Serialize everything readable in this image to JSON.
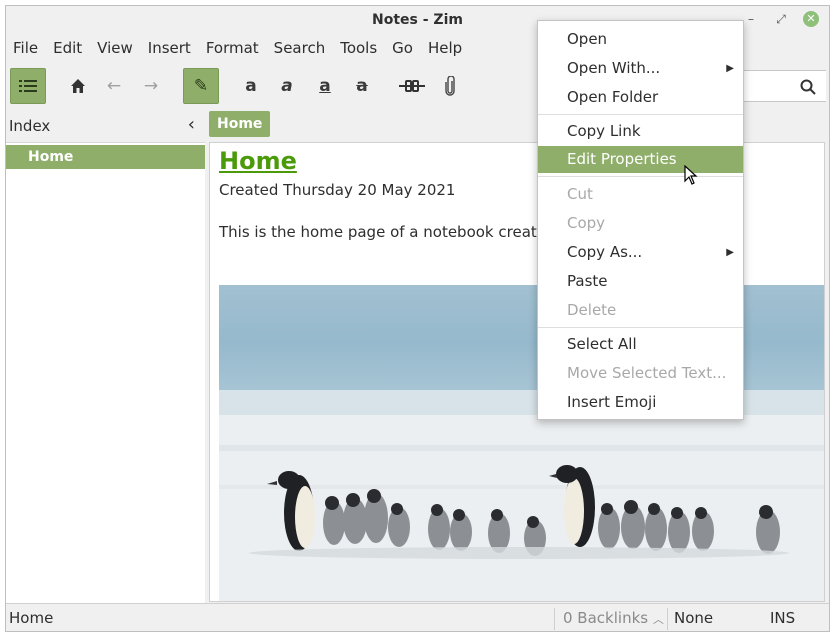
{
  "window": {
    "title": "Notes - Zim"
  },
  "menubar": [
    "File",
    "Edit",
    "View",
    "Insert",
    "Format",
    "Search",
    "Tools",
    "Go",
    "Help"
  ],
  "toolbar": {
    "index_icon": "list-icon",
    "home_icon": "home-icon",
    "back_icon": "arrow-left-icon",
    "forward_icon": "arrow-right-icon",
    "edit_icon": "pencil-icon",
    "bold": "a",
    "italic": "a",
    "underline": "a",
    "strike": "a"
  },
  "sidebar": {
    "title": "Index",
    "items": [
      {
        "label": "Home"
      }
    ]
  },
  "pathbar": {
    "current": "Home"
  },
  "editor": {
    "heading": "Home",
    "created": "Created Thursday 20 May 2021",
    "intro": "This is the home page of a notebook created u"
  },
  "statusbar": {
    "page": "Home",
    "backlinks": "0 Backlinks",
    "style": "None",
    "mode": "INS"
  },
  "context_menu": {
    "items": [
      {
        "label": "Open",
        "enabled": true
      },
      {
        "label": "Open With...",
        "enabled": true,
        "submenu": true
      },
      {
        "label": "Open Folder",
        "enabled": true
      },
      {
        "label": "Copy Link",
        "enabled": true
      },
      {
        "label": "Edit Properties",
        "enabled": true,
        "highlighted": true
      },
      {
        "label": "Cut",
        "enabled": false
      },
      {
        "label": "Copy",
        "enabled": false
      },
      {
        "label": "Copy As...",
        "enabled": true,
        "submenu": true
      },
      {
        "label": "Paste",
        "enabled": true
      },
      {
        "label": "Delete",
        "enabled": false
      },
      {
        "label": "Select All",
        "enabled": true
      },
      {
        "label": "Move Selected Text...",
        "enabled": false
      },
      {
        "label": "Insert Emoji",
        "enabled": true
      }
    ]
  },
  "colors": {
    "accent": "#8fae6a",
    "heading_link": "#4a9a0a",
    "close_button": "#8fc07a"
  }
}
